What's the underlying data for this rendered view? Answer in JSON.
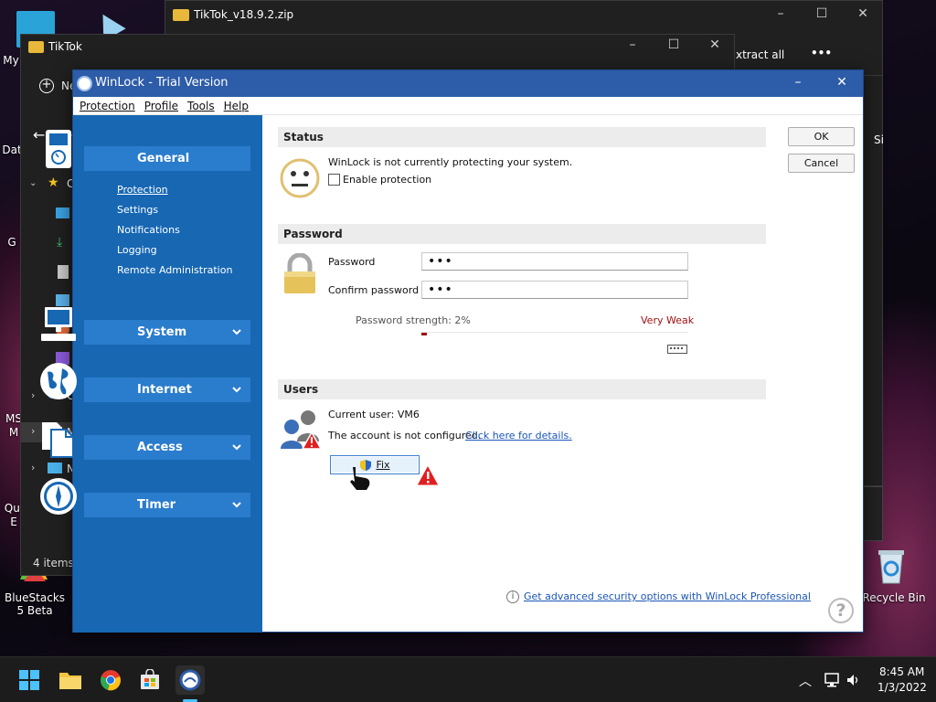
{
  "desktop": {
    "icons": [
      {
        "label": "My"
      },
      {
        "label": "Dat"
      },
      {
        "label": "G"
      },
      {
        "label": "MS"
      },
      {
        "label": "M"
      },
      {
        "label": "Qui"
      },
      {
        "label": "E"
      }
    ],
    "bluestacks_label": "BlueStacks 5 Beta",
    "recycle_label": "Recycle Bin"
  },
  "zip_window": {
    "title": "TikTok_v18.9.2.zip",
    "extract_label": "xtract all",
    "more_label": "•••",
    "right_fragment": "Si"
  },
  "explorer": {
    "title": "TikTok",
    "new_label": "Ne",
    "nav_letters": [
      "C",
      "C",
      "M",
      "N"
    ],
    "status": "4 items"
  },
  "winlock": {
    "title": "WinLock - Trial Version",
    "minimize": "–",
    "close": "✕",
    "menu": [
      "Protection",
      "Profile",
      "Tools",
      "Help"
    ],
    "sidebar": {
      "general": "General",
      "sub_items": [
        "Protection",
        "Settings",
        "Notifications",
        "Logging",
        "Remote Administration"
      ],
      "system": "System",
      "internet": "Internet",
      "access": "Access",
      "timer": "Timer"
    },
    "status": {
      "header": "Status",
      "message": "WinLock is not currently protecting your system.",
      "enable_label": "Enable protection"
    },
    "password": {
      "header": "Password",
      "password_label": "Password",
      "password_value": "•••",
      "confirm_label": "Confirm password",
      "confirm_value": "•••",
      "strength_label": "Password strength: 2%",
      "strength_rating": "Very Weak",
      "strength_percent": 2
    },
    "users": {
      "header": "Users",
      "current_user": "Current user:  VM6",
      "account_msg": "The account is not configured.",
      "details_link": "Click here for details.",
      "fix_label": "Fix"
    },
    "ok_label": "OK",
    "cancel_label": "Cancel",
    "pro_link": "Get advanced security options with WinLock Professional",
    "help_glyph": "?"
  },
  "taskbar": {
    "time": "8:45 AM",
    "date": "1/3/2022"
  },
  "colors": {
    "titlebar": "#2d5ca8",
    "sidebar": "#1767b3",
    "sidebar_active": "#2a7ccc",
    "weak": "#a01010",
    "link": "#1a55b8"
  }
}
